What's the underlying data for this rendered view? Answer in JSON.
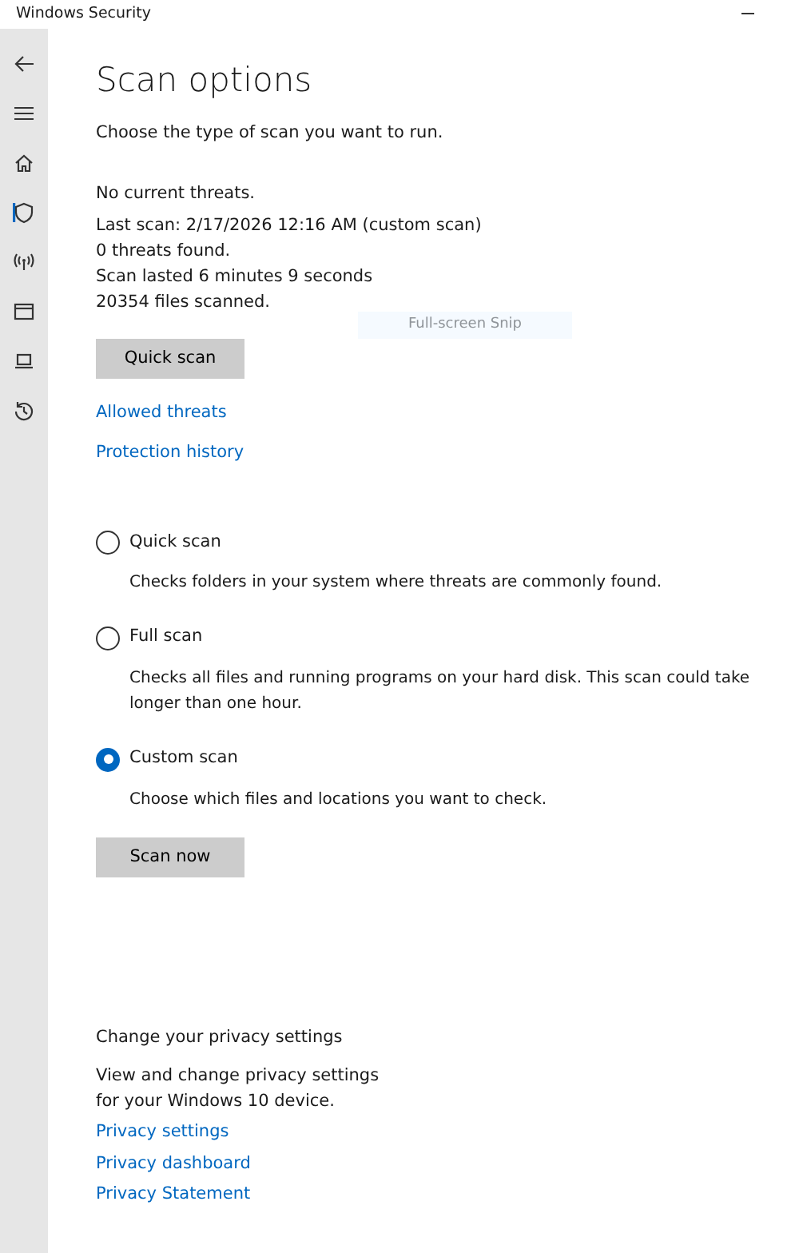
{
  "window": {
    "title": "Windows Security"
  },
  "sidebar": {
    "items": [
      {
        "selected": false
      },
      {
        "selected": true
      },
      {
        "selected": false
      },
      {
        "selected": false
      },
      {
        "selected": false
      },
      {
        "selected": false
      }
    ]
  },
  "page": {
    "title": "Scan options",
    "subtitle": "Choose the type of scan you want to run.",
    "status": [
      "No current threats.",
      "Last scan: 2/17/2026 12:16 AM (custom scan)",
      "0 threats found.",
      "Scan lasted 6 minutes 9 seconds",
      "20354 files scanned."
    ],
    "quick_button": "Quick scan",
    "overlay": "Full-screen Snip",
    "links": [
      "Allowed threats",
      "Protection history"
    ],
    "options": [
      {
        "label": "Quick scan",
        "description": "Checks folders in your system where threats are commonly found.",
        "selected": false
      },
      {
        "label": "Full scan",
        "description": "Checks all files and running programs on your hard disk. This scan could take longer than one hour.",
        "selected": false
      },
      {
        "label": "Custom scan",
        "description": "Choose which files and locations you want to check.",
        "selected": true
      }
    ],
    "scan_button": "Scan now"
  },
  "privacy": {
    "title": "Change your privacy settings",
    "text": "View and change privacy settings for your Windows 10 device.",
    "links": [
      "Privacy settings",
      "Privacy dashboard",
      "Privacy Statement"
    ]
  }
}
